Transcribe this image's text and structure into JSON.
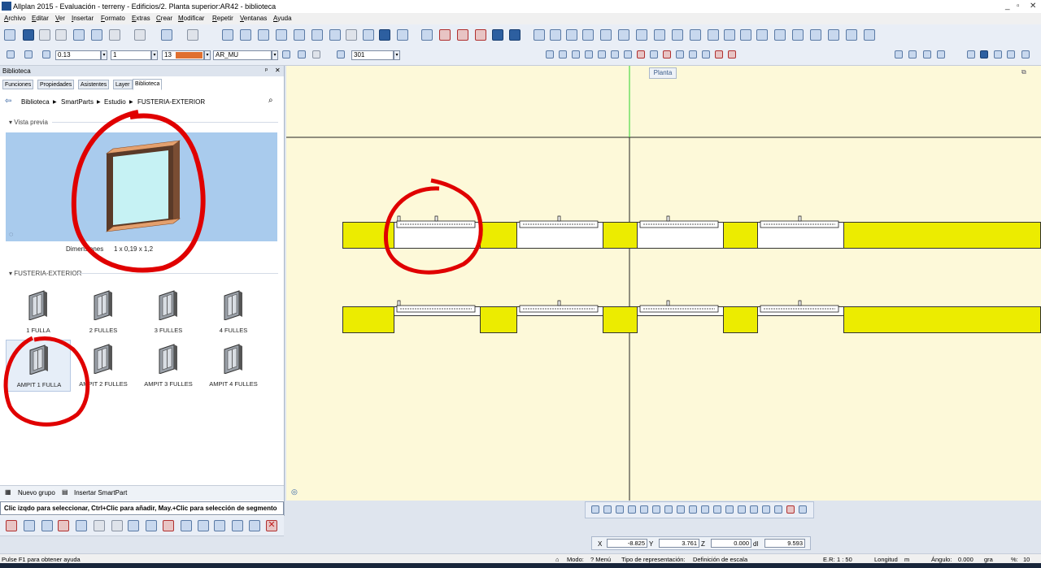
{
  "window": {
    "title": "Allplan 2015 - Evaluación - terreny - Edificios/2. Planta superior:AR42 - biblioteca",
    "controls": [
      "_",
      "▫",
      "✕"
    ]
  },
  "menu": [
    "Archivo",
    "Editar",
    "Ver",
    "Insertar",
    "Formato",
    "Extras",
    "Crear",
    "Modificar",
    "Repetir",
    "Ventanas",
    "Ayuda"
  ],
  "format_bar": {
    "pen": "0.13",
    "line": "1",
    "color": "13",
    "color_hex": "#e07030",
    "layer": "AR_MU",
    "hatch": "301"
  },
  "panel": {
    "title": "Biblioteca",
    "pin": "ᵖ",
    "close": "✕",
    "tabs": [
      "Funciones",
      "Propiedades",
      "Asistentes",
      "Layer",
      "Biblioteca"
    ],
    "breadcrumb": [
      "Biblioteca",
      "SmartParts",
      "Estudio",
      "FUSTERIA-EXTERIOR"
    ],
    "preview_section": "Vista previa",
    "dimensions_label": "Dimensiones",
    "dimensions_value": "1 x 0,19 x 1,2",
    "group_section": "FUSTERIA-EXTERIOR",
    "items": [
      {
        "label": "1 FULLA"
      },
      {
        "label": "2 FULLES"
      },
      {
        "label": "3 FULLES"
      },
      {
        "label": "4 FULLES"
      },
      {
        "label": "AMPIT 1 FULLA"
      },
      {
        "label": "AMPIT 2 FULLES"
      },
      {
        "label": "AMPIT 3 FULLES"
      },
      {
        "label": "AMPIT 4 FULLES"
      }
    ],
    "footer": {
      "new_group": "Nuevo grupo",
      "insert_smartpart": "Insertar SmartPart"
    },
    "hint": "Clic izqdo para seleccionar, Ctrl+Clic para añadir, May.+Clic para selección de segmento"
  },
  "viewport": {
    "tab": "Planta",
    "wall_color": "#ecec00"
  },
  "coords": {
    "x_label": "X",
    "x": "-8.825",
    "y_label": "Y",
    "y": "3.761",
    "z_label": "Z",
    "z": "0.000",
    "d_label": "dl",
    "d": "9.593"
  },
  "status": {
    "help": "Pulse F1 para obtener ayuda",
    "mode": "Modo:",
    "mode_value": "? Menú",
    "repr": "Tipo de representación:",
    "repr_value": "Definición de escala",
    "scale": "E.R:",
    "scale_value": "1 : 50",
    "length": "Longitud",
    "length_value": "m",
    "angle": "Ángulo:",
    "angle_value": "0.000",
    "angle_unit": "gra",
    "zoom": "%:",
    "zoom_value": "10"
  }
}
